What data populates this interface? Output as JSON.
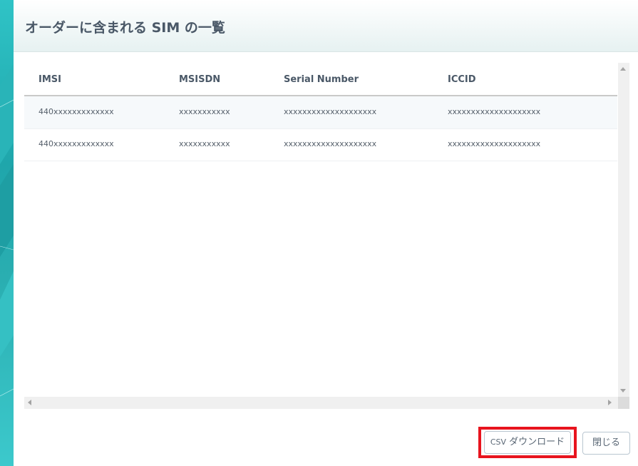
{
  "modal": {
    "title": "オーダーに含まれる SIM の一覧"
  },
  "table": {
    "columns": [
      "IMSI",
      "MSISDN",
      "Serial Number",
      "ICCID"
    ],
    "rows": [
      [
        "440xxxxxxxxxxxxx",
        "xxxxxxxxxxx",
        "xxxxxxxxxxxxxxxxxxxx",
        "xxxxxxxxxxxxxxxxxxxx"
      ],
      [
        "440xxxxxxxxxxxxx",
        "xxxxxxxxxxx",
        "xxxxxxxxxxxxxxxxxxxx",
        "xxxxxxxxxxxxxxxxxxxx"
      ]
    ]
  },
  "footer": {
    "csv_prefix": "CSV",
    "csv_label": "ダウンロード",
    "close_label": "閉じる"
  },
  "colors": {
    "highlight": "#e8141e",
    "teal_background": "#2fc3c6",
    "title_text": "#4a5867"
  }
}
